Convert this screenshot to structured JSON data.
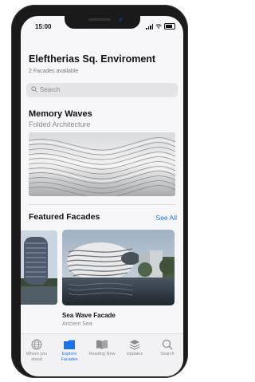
{
  "status": {
    "time": "15:00"
  },
  "header": {
    "title": "Eleftherias Sq. Enviroment",
    "subtitle": "2 Facades available"
  },
  "search": {
    "placeholder": "Search"
  },
  "featured_main": {
    "title": "Memory Waves",
    "subtitle": "Folded Architecture"
  },
  "featured_section": {
    "title": "Featured Facades",
    "see_all": "See All",
    "cards": [
      {
        "title": "Sea Wave Facade",
        "subtitle": "Ancient Sea"
      }
    ]
  },
  "tabbar": {
    "accent": "#1a73e8",
    "items": [
      {
        "label": "Where you stand",
        "icon": "globe-icon",
        "active": false
      },
      {
        "label": "Explore Facades",
        "icon": "folder-icon",
        "active": true
      },
      {
        "label": "Reading Now",
        "icon": "book-icon",
        "active": false
      },
      {
        "label": "Updates",
        "icon": "layers-icon",
        "active": false
      },
      {
        "label": "Search",
        "icon": "search-icon",
        "active": false
      }
    ]
  }
}
